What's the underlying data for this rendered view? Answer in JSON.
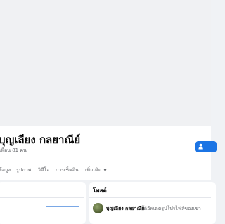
{
  "profile": {
    "name": "บุญเลียง กลยาณีย์",
    "friends_text": "เพื่อน 81 คน"
  },
  "tabs": [
    {
      "label": "ข้อมูล"
    },
    {
      "label": "รูปภาพ"
    },
    {
      "label": "วิดีโอ"
    },
    {
      "label": "การเช็คอิน"
    },
    {
      "label": "เพิ่มเติม"
    }
  ],
  "posts": {
    "title": "โพสต์",
    "first_post": {
      "author": "บุญเลียง กลยาณีย์",
      "action": "ได้อัพเดตรูปโปรไฟล์ของเขา"
    }
  },
  "colors": {
    "accent": "#1b74e4",
    "page_background": "#f0f2f5",
    "text_primary": "#050505",
    "text_secondary": "#65676b"
  },
  "icons": {
    "add_friend": "person-add-icon",
    "more_caret": "caret-down-icon"
  }
}
